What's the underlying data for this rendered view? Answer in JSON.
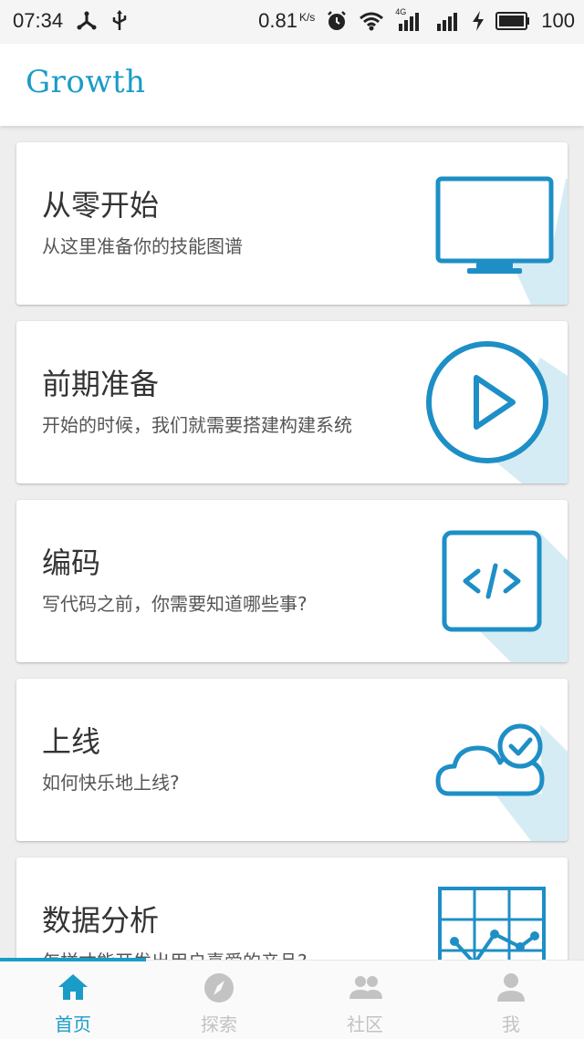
{
  "status_bar": {
    "time": "07:34",
    "net_speed": "0.81",
    "net_unit": "K/s",
    "network_type": "4G",
    "battery": "100",
    "icons": [
      "usb-icon",
      "usb-debug-icon",
      "alarm-icon",
      "wifi-icon",
      "signal-icon",
      "charging-icon",
      "battery-icon"
    ]
  },
  "app_bar": {
    "title": "Growth"
  },
  "cards": [
    {
      "title": "从零开始",
      "subtitle": "从这里准备你的技能图谱",
      "icon": "monitor-icon"
    },
    {
      "title": "前期准备",
      "subtitle": "开始的时候，我们就需要搭建构建系统",
      "icon": "play-icon"
    },
    {
      "title": "编码",
      "subtitle": "写代码之前，你需要知道哪些事?",
      "icon": "code-icon"
    },
    {
      "title": "上线",
      "subtitle": "如何快乐地上线?",
      "icon": "cloud-check-icon"
    },
    {
      "title": "数据分析",
      "subtitle": "怎样才能开发出用户喜爱的产品?",
      "icon": "chart-icon"
    }
  ],
  "bottom_nav": {
    "items": [
      {
        "label": "首页",
        "icon": "home-icon",
        "active": true
      },
      {
        "label": "探索",
        "icon": "compass-icon",
        "active": false
      },
      {
        "label": "社区",
        "icon": "people-icon",
        "active": false
      },
      {
        "label": "我",
        "icon": "person-icon",
        "active": false
      }
    ]
  },
  "colors": {
    "accent": "#1a9cc8",
    "icon_blue": "#1e8fc6",
    "shadow_blue": "#d6ecf4",
    "inactive": "#c3c3c3"
  }
}
